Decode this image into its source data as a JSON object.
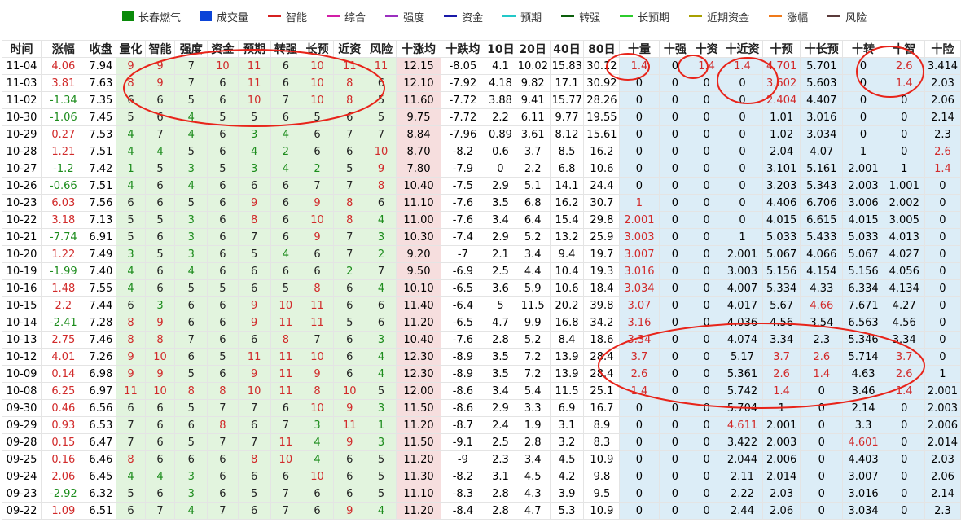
{
  "legend": [
    {
      "label": "长春燃气",
      "color": "#0a8a0a",
      "shape": "box"
    },
    {
      "label": "成交量",
      "color": "#0b44d8",
      "shape": "box"
    },
    {
      "label": "智能",
      "color": "#d62020",
      "shape": "line"
    },
    {
      "label": "综合",
      "color": "#d21ea7",
      "shape": "line"
    },
    {
      "label": "强度",
      "color": "#9b2fbf",
      "shape": "line"
    },
    {
      "label": "资金",
      "color": "#1919a8",
      "shape": "line"
    },
    {
      "label": "预期",
      "color": "#22c8c8",
      "shape": "line"
    },
    {
      "label": "转强",
      "color": "#0b5e0b",
      "shape": "line"
    },
    {
      "label": "长预期",
      "color": "#2ccc2c",
      "shape": "line"
    },
    {
      "label": "近期资金",
      "color": "#a8a000",
      "shape": "line"
    },
    {
      "label": "涨幅",
      "color": "#f07a1a",
      "shape": "line"
    },
    {
      "label": "风险",
      "color": "#5a3a3a",
      "shape": "line"
    }
  ],
  "columns": [
    "时间",
    "涨幅",
    "收盘",
    "量化",
    "智能",
    "强度",
    "资金",
    "预期",
    "转强",
    "长预",
    "近资",
    "风险",
    "十涨均",
    "十跌均",
    "10日",
    "20日",
    "40日",
    "80日",
    "十量",
    "十强",
    "十资",
    "十近资",
    "十预",
    "十长预",
    "十转",
    "十智",
    "十险"
  ],
  "rows": [
    [
      "11-04",
      "4.06",
      "7.94",
      "9",
      "9",
      "7",
      "10",
      "11",
      "6",
      "10",
      "11",
      "11",
      "12.15",
      "-8.05",
      "4.1",
      "10.02",
      "15.83",
      "30.12",
      "1.4",
      "0",
      "1.4",
      "1.4",
      "4.701",
      "5.701",
      "0",
      "2.6",
      "3.414"
    ],
    [
      "11-03",
      "3.81",
      "7.63",
      "8",
      "9",
      "7",
      "6",
      "11",
      "6",
      "10",
      "8",
      "6",
      "12.10",
      "-7.92",
      "4.18",
      "9.82",
      "17.1",
      "30.92",
      "0",
      "0",
      "0",
      "0",
      "3.602",
      "5.603",
      "0",
      "1.4",
      "2.03"
    ],
    [
      "11-02",
      "-1.34",
      "7.35",
      "6",
      "6",
      "5",
      "6",
      "10",
      "7",
      "10",
      "8",
      "5",
      "11.60",
      "-7.72",
      "3.88",
      "9.41",
      "15.77",
      "28.26",
      "0",
      "0",
      "0",
      "0",
      "2.404",
      "4.407",
      "0",
      "0",
      "2.06"
    ],
    [
      "10-30",
      "-1.06",
      "7.45",
      "5",
      "6",
      "4",
      "5",
      "5",
      "6",
      "5",
      "6",
      "5",
      "9.75",
      "-7.72",
      "2.2",
      "6.11",
      "9.77",
      "19.55",
      "0",
      "0",
      "0",
      "0",
      "1.01",
      "3.016",
      "0",
      "0",
      "2.14"
    ],
    [
      "10-29",
      "0.27",
      "7.53",
      "4",
      "7",
      "4",
      "6",
      "3",
      "4",
      "6",
      "7",
      "7",
      "8.84",
      "-7.96",
      "0.89",
      "3.61",
      "8.12",
      "15.61",
      "0",
      "0",
      "0",
      "0",
      "1.02",
      "3.034",
      "0",
      "0",
      "2.3"
    ],
    [
      "10-28",
      "1.21",
      "7.51",
      "4",
      "4",
      "5",
      "6",
      "4",
      "2",
      "6",
      "6",
      "10",
      "8.70",
      "-8.2",
      "0.6",
      "3.7",
      "8.5",
      "16.2",
      "0",
      "0",
      "0",
      "0",
      "2.04",
      "4.07",
      "1",
      "0",
      "2.6"
    ],
    [
      "10-27",
      "-1.2",
      "7.42",
      "1",
      "5",
      "3",
      "5",
      "3",
      "4",
      "2",
      "5",
      "9",
      "7.80",
      "-7.9",
      "0",
      "2.2",
      "6.8",
      "10.6",
      "0",
      "0",
      "0",
      "0",
      "3.101",
      "5.161",
      "2.001",
      "1",
      "1.4"
    ],
    [
      "10-26",
      "-0.66",
      "7.51",
      "4",
      "6",
      "4",
      "6",
      "6",
      "6",
      "7",
      "7",
      "8",
      "10.40",
      "-7.5",
      "2.9",
      "5.1",
      "14.1",
      "24.4",
      "0",
      "0",
      "0",
      "0",
      "3.203",
      "5.343",
      "2.003",
      "1.001",
      "0"
    ],
    [
      "10-23",
      "6.03",
      "7.56",
      "6",
      "6",
      "5",
      "6",
      "9",
      "6",
      "9",
      "8",
      "6",
      "11.10",
      "-7.6",
      "3.5",
      "6.8",
      "16.2",
      "30.7",
      "1",
      "0",
      "0",
      "0",
      "4.406",
      "6.706",
      "3.006",
      "2.002",
      "0"
    ],
    [
      "10-22",
      "3.18",
      "7.13",
      "5",
      "5",
      "3",
      "6",
      "8",
      "6",
      "10",
      "8",
      "4",
      "11.00",
      "-7.6",
      "3.4",
      "6.4",
      "15.4",
      "29.8",
      "2.001",
      "0",
      "0",
      "0",
      "4.015",
      "6.615",
      "4.015",
      "3.005",
      "0"
    ],
    [
      "10-21",
      "-7.74",
      "6.91",
      "5",
      "6",
      "3",
      "6",
      "7",
      "6",
      "9",
      "7",
      "3",
      "10.30",
      "-7.4",
      "2.9",
      "5.2",
      "13.2",
      "25.9",
      "3.003",
      "0",
      "0",
      "1",
      "5.033",
      "5.433",
      "5.033",
      "4.013",
      "0"
    ],
    [
      "10-20",
      "1.22",
      "7.49",
      "3",
      "5",
      "3",
      "6",
      "5",
      "4",
      "6",
      "7",
      "2",
      "9.20",
      "-7",
      "2.1",
      "3.4",
      "9.4",
      "19.7",
      "3.007",
      "0",
      "0",
      "2.001",
      "5.067",
      "4.066",
      "5.067",
      "4.027",
      "0"
    ],
    [
      "10-19",
      "-1.99",
      "7.40",
      "4",
      "6",
      "4",
      "6",
      "6",
      "6",
      "6",
      "2",
      "7",
      "9.50",
      "-6.9",
      "2.5",
      "4.4",
      "10.4",
      "19.3",
      "3.016",
      "0",
      "0",
      "3.003",
      "5.156",
      "4.154",
      "5.156",
      "4.056",
      "0"
    ],
    [
      "10-16",
      "1.48",
      "7.55",
      "4",
      "6",
      "5",
      "5",
      "6",
      "5",
      "8",
      "6",
      "4",
      "10.10",
      "-6.5",
      "3.6",
      "5.9",
      "10.6",
      "18.4",
      "3.034",
      "0",
      "0",
      "4.007",
      "5.334",
      "4.33",
      "6.334",
      "4.134",
      "0"
    ],
    [
      "10-15",
      "2.2",
      "7.44",
      "6",
      "3",
      "6",
      "6",
      "9",
      "10",
      "11",
      "6",
      "6",
      "11.40",
      "-6.4",
      "5",
      "11.5",
      "20.2",
      "39.8",
      "3.07",
      "0",
      "0",
      "4.017",
      "5.67",
      "4.66",
      "7.671",
      "4.27",
      "0"
    ],
    [
      "10-14",
      "-2.41",
      "7.28",
      "8",
      "9",
      "6",
      "6",
      "9",
      "11",
      "11",
      "5",
      "6",
      "11.20",
      "-6.5",
      "4.7",
      "9.9",
      "16.8",
      "34.2",
      "3.16",
      "0",
      "0",
      "4.036",
      "4.56",
      "3.54",
      "6.563",
      "4.56",
      "0"
    ],
    [
      "10-13",
      "2.75",
      "7.46",
      "8",
      "8",
      "7",
      "6",
      "6",
      "8",
      "7",
      "6",
      "3",
      "10.40",
      "-7.6",
      "2.8",
      "5.2",
      "8.4",
      "18.6",
      "3.34",
      "0",
      "0",
      "4.074",
      "3.34",
      "2.3",
      "5.346",
      "3.34",
      "0"
    ],
    [
      "10-12",
      "4.01",
      "7.26",
      "9",
      "10",
      "6",
      "5",
      "11",
      "11",
      "10",
      "6",
      "4",
      "12.30",
      "-8.9",
      "3.5",
      "7.2",
      "13.9",
      "28.4",
      "3.7",
      "0",
      "0",
      "5.17",
      "3.7",
      "2.6",
      "5.714",
      "3.7",
      "0"
    ],
    [
      "10-09",
      "0.14",
      "6.98",
      "9",
      "9",
      "5",
      "6",
      "9",
      "11",
      "9",
      "6",
      "4",
      "12.30",
      "-8.9",
      "3.5",
      "7.2",
      "13.9",
      "28.4",
      "2.6",
      "0",
      "0",
      "5.361",
      "2.6",
      "1.4",
      "4.63",
      "2.6",
      "1"
    ],
    [
      "10-08",
      "6.25",
      "6.97",
      "11",
      "10",
      "8",
      "8",
      "10",
      "11",
      "8",
      "10",
      "5",
      "12.00",
      "-8.6",
      "3.4",
      "5.4",
      "11.5",
      "25.1",
      "1.4",
      "0",
      "0",
      "5.742",
      "1.4",
      "0",
      "3.46",
      "1.4",
      "2.001"
    ],
    [
      "09-30",
      "0.46",
      "6.56",
      "6",
      "6",
      "5",
      "7",
      "7",
      "6",
      "10",
      "9",
      "3",
      "11.50",
      "-8.6",
      "2.9",
      "3.3",
      "6.9",
      "16.7",
      "0",
      "0",
      "0",
      "5.704",
      "1",
      "0",
      "2.14",
      "0",
      "2.003"
    ],
    [
      "09-29",
      "0.93",
      "6.53",
      "7",
      "6",
      "6",
      "8",
      "6",
      "7",
      "3",
      "11",
      "1",
      "11.20",
      "-8.7",
      "2.4",
      "1.9",
      "3.1",
      "8.9",
      "0",
      "0",
      "0",
      "4.611",
      "2.001",
      "0",
      "3.3",
      "0",
      "2.006"
    ],
    [
      "09-28",
      "0.15",
      "6.47",
      "7",
      "6",
      "5",
      "7",
      "7",
      "11",
      "4",
      "9",
      "3",
      "11.50",
      "-9.1",
      "2.5",
      "2.8",
      "3.2",
      "8.3",
      "0",
      "0",
      "0",
      "3.422",
      "2.003",
      "0",
      "4.601",
      "0",
      "2.014"
    ],
    [
      "09-25",
      "0.16",
      "6.46",
      "8",
      "6",
      "6",
      "6",
      "8",
      "10",
      "4",
      "6",
      "5",
      "11.20",
      "-9",
      "2.3",
      "3.4",
      "4.5",
      "10.9",
      "0",
      "0",
      "0",
      "2.044",
      "2.006",
      "0",
      "4.403",
      "0",
      "2.03"
    ],
    [
      "09-24",
      "2.06",
      "6.45",
      "4",
      "4",
      "3",
      "6",
      "6",
      "6",
      "10",
      "6",
      "5",
      "11.30",
      "-8.2",
      "3.1",
      "4.5",
      "4.2",
      "9.8",
      "0",
      "0",
      "0",
      "2.11",
      "2.014",
      "0",
      "3.007",
      "0",
      "2.06"
    ],
    [
      "09-23",
      "-2.92",
      "6.32",
      "5",
      "6",
      "3",
      "6",
      "5",
      "7",
      "6",
      "6",
      "5",
      "11.10",
      "-8.3",
      "2.8",
      "4.3",
      "3.9",
      "9.5",
      "0",
      "0",
      "0",
      "2.22",
      "2.03",
      "0",
      "3.016",
      "0",
      "2.14"
    ],
    [
      "09-22",
      "1.09",
      "6.51",
      "6",
      "7",
      "4",
      "7",
      "6",
      "7",
      "6",
      "9",
      "4",
      "11.20",
      "-8.4",
      "2.8",
      "4.7",
      "5.3",
      "10.9",
      "0",
      "0",
      "0",
      "2.44",
      "2.06",
      "0",
      "3.034",
      "0",
      "2.3"
    ]
  ],
  "colors": {
    "rise": "#d12a2a",
    "fall": "#1c8c1c",
    "ellipse": "#e8241a",
    "green_bg": "#e2f4de",
    "pink_bg": "#f6dede",
    "blue_bg": "#dcedf7"
  }
}
